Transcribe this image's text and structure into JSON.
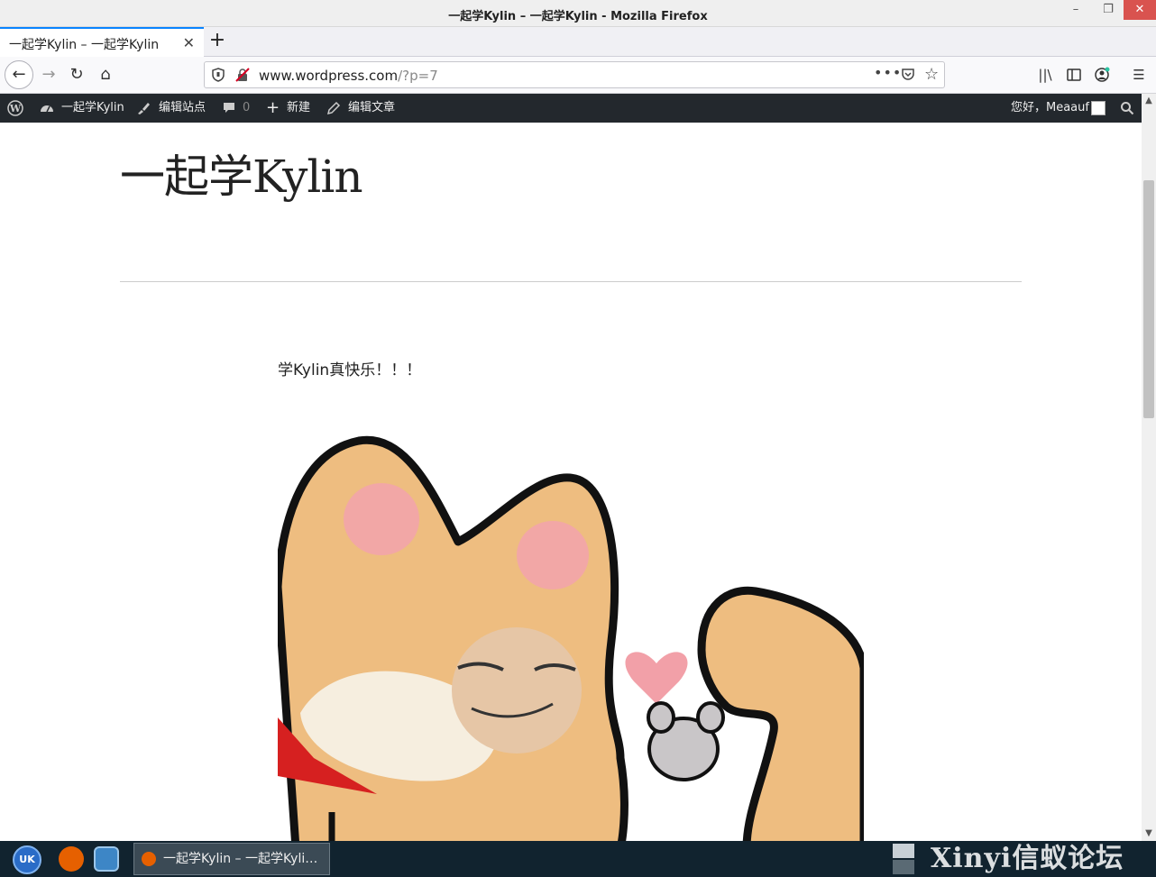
{
  "window": {
    "title": "一起学Kylin – 一起学Kylin - Mozilla Firefox",
    "min_icon": "minimize-icon",
    "max_icon": "restore-icon",
    "close_icon": "close-icon"
  },
  "tabs": [
    {
      "label": "一起学Kylin – 一起学Kylin",
      "active": true
    }
  ],
  "navbar": {
    "url_host": "www.wordpress.com",
    "url_path": "/?p=7",
    "more_label": "•••"
  },
  "adminbar": {
    "site_name": "一起学Kylin",
    "customize": "编辑站点",
    "comments_count": "0",
    "new_label": "新建",
    "edit_post": "编辑文章",
    "greeting": "您好，Meaauf"
  },
  "page": {
    "site_title": "一起学Kylin",
    "post_text": "学Kylin真快乐！！！"
  },
  "taskbar": {
    "start_label": "UK",
    "window_label": "一起学Kylin – 一起学Kyli…",
    "watermark": "Xinyi信蚁论坛"
  },
  "colors": {
    "adminbar_bg": "#23282d",
    "accent": "#0a84ff",
    "taskbar_bg": "#11232f",
    "close_btn": "#d9534f"
  }
}
